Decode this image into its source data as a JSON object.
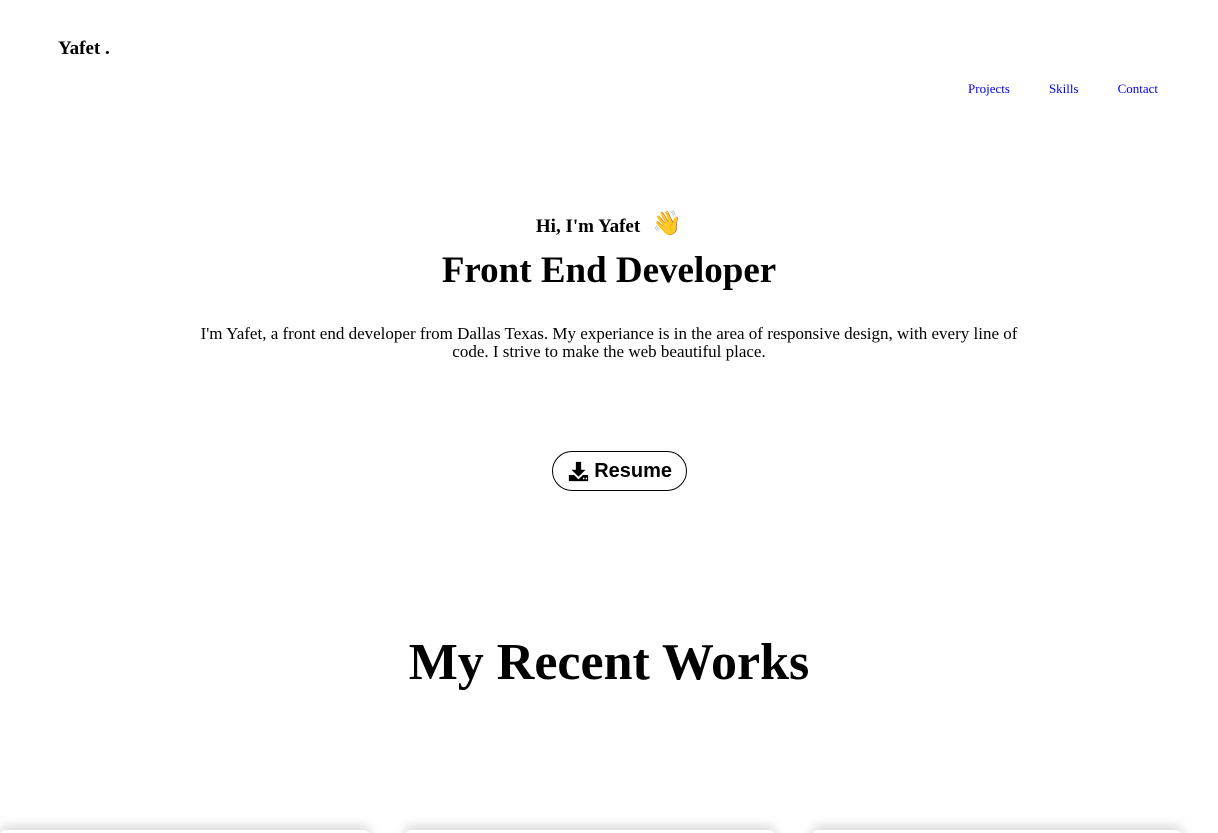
{
  "header": {
    "brand": "Yafet .",
    "nav": [
      {
        "label": "Projects"
      },
      {
        "label": "Skills"
      },
      {
        "label": "Contact"
      }
    ]
  },
  "hero": {
    "greeting": "Hi, I'm Yafet",
    "wave_emoji": "👋",
    "role": "Front End Developer",
    "intro": "I'm Yafet, a front end developer from Dallas Texas. My experiance is in the area of responsive design, with every line of code. I strive to make the web beautiful place.",
    "resume_label": "Resume",
    "resume_icon": "download-icon"
  },
  "works": {
    "title": "My Recent Works"
  }
}
